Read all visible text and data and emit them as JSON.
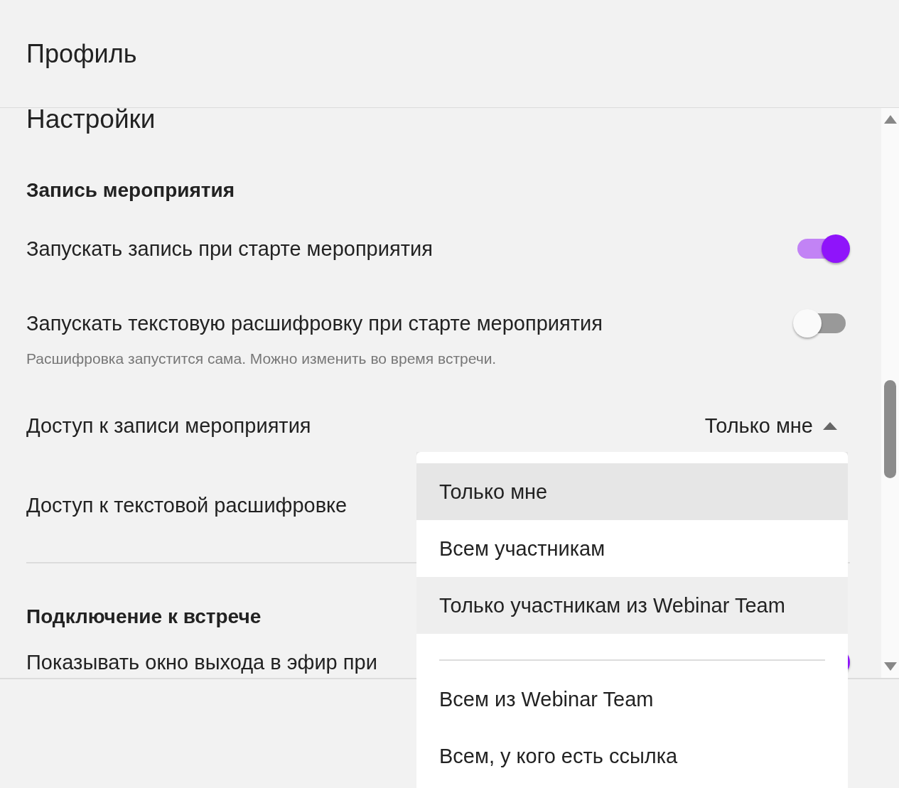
{
  "header": {
    "title": "Профиль"
  },
  "settings": {
    "title": "Настройки",
    "sections": [
      {
        "heading": "Запись мероприятия",
        "rows": [
          {
            "kind": "toggle",
            "label": "Запускать запись при старте мероприятия",
            "on": true
          },
          {
            "kind": "toggle",
            "label": "Запускать текстовую расшифровку при старте мероприятия",
            "on": false,
            "hint": "Расшифровка запустится сама. Можно изменить во время встречи."
          },
          {
            "kind": "select",
            "label": "Доступ к записи мероприятия",
            "value": "Только мне",
            "expanded": true
          },
          {
            "kind": "select",
            "label": "Доступ к текстовой расшифровке"
          }
        ]
      },
      {
        "heading": "Подключение к встрече",
        "rows": [
          {
            "kind": "toggle",
            "label": "Показывать окно выхода в эфир при",
            "on": true
          }
        ]
      }
    ]
  },
  "dropdown": {
    "groups": [
      {
        "items": [
          {
            "label": "Только мне",
            "selected": true,
            "highlighted": false
          },
          {
            "label": "Всем участникам",
            "selected": false,
            "highlighted": false
          },
          {
            "label": "Только участникам из Webinar Team",
            "selected": false,
            "highlighted": true
          }
        ]
      },
      {
        "items": [
          {
            "label": "Всем из Webinar Team",
            "selected": false,
            "highlighted": false
          },
          {
            "label": "Всем, у кого есть ссылка",
            "selected": false,
            "highlighted": false
          }
        ]
      }
    ]
  }
}
